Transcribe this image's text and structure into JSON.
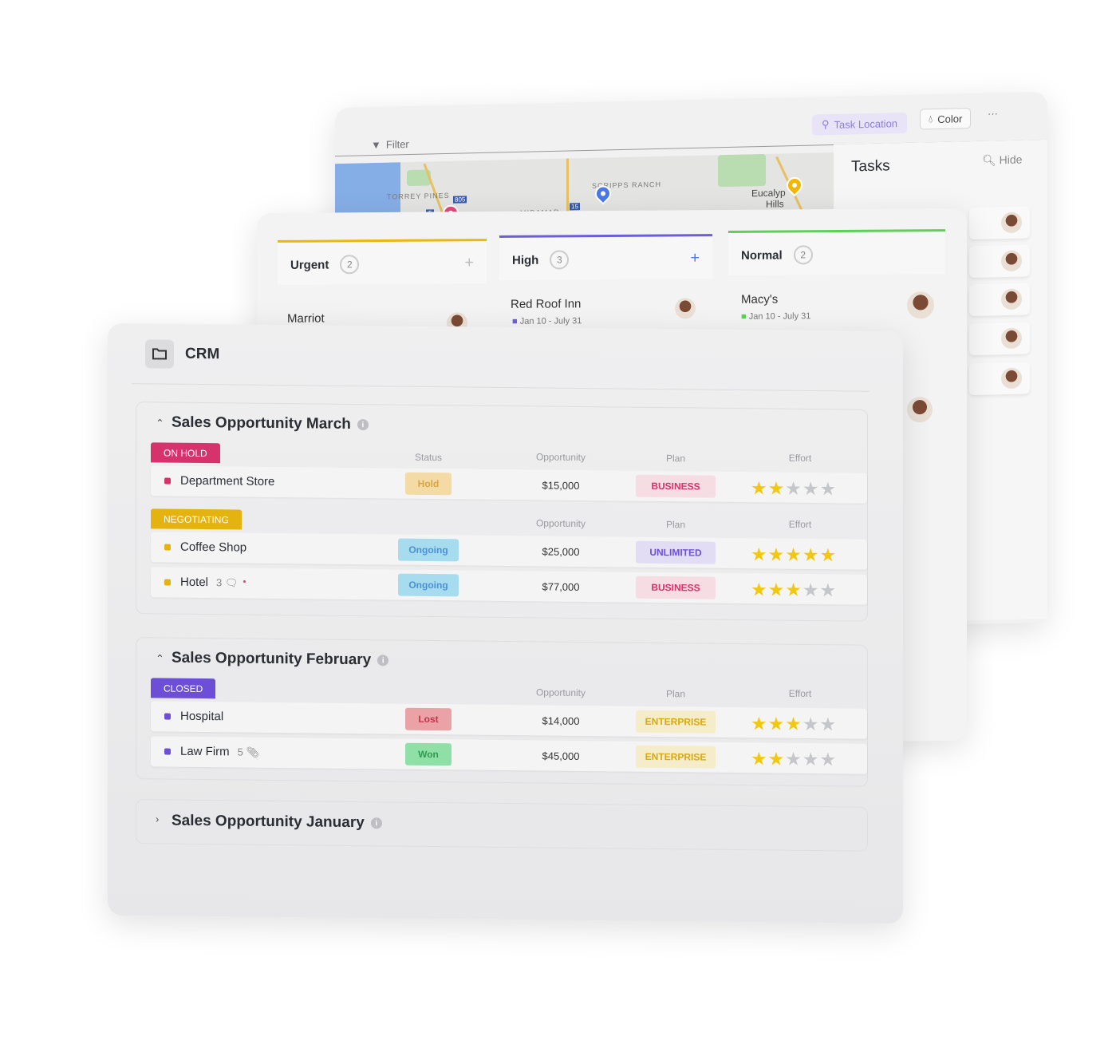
{
  "map_view": {
    "toolbar": {
      "filter_label": "Filter",
      "task_location_label": "Task Location",
      "color_label": "Color",
      "more_label": "···"
    },
    "map_labels": [
      "TORREY PINES",
      "SCRIPPS RANCH",
      "MIRAMAR",
      "Eucalyp",
      "Hills"
    ],
    "highway_shields": [
      "805",
      "5",
      "15"
    ],
    "pin_colors": [
      "#e6487a",
      "#4a78e8",
      "#f2b705"
    ],
    "tasks_panel": {
      "title": "Tasks",
      "hide_label": "Hide"
    }
  },
  "board_view": {
    "columns": [
      {
        "label": "Urgent",
        "count": "2",
        "color": "#e7b812",
        "card": {
          "title": "Marriot"
        }
      },
      {
        "label": "High",
        "count": "3",
        "color": "#6b5fd6",
        "card": {
          "title": "Red Roof Inn",
          "dates": "Jan 10 - July 31"
        }
      },
      {
        "label": "Normal",
        "count": "2",
        "color": "#5fcf5a",
        "card": {
          "title": "Macy's",
          "dates": "Jan 10 - July 31"
        }
      }
    ]
  },
  "crm": {
    "title": "CRM",
    "headers": {
      "status": "Status",
      "opportunity": "Opportunity",
      "plan": "Plan",
      "effort": "Effort"
    },
    "sections": [
      {
        "title": "Sales Opportunity March",
        "expanded": true,
        "groups": [
          {
            "label": "ON HOLD",
            "color": "#d6336c",
            "show_status_header": true,
            "rows": [
              {
                "name": "Department Store",
                "status": "Hold",
                "opportunity": "$15,000",
                "plan": "BUSINESS",
                "effort": 2
              }
            ]
          },
          {
            "label": "NEGOTIATING",
            "color": "#e4b30f",
            "show_status_header": false,
            "rows": [
              {
                "name": "Coffee Shop",
                "status": "Ongoing",
                "opportunity": "$25,000",
                "plan": "UNLIMITED",
                "effort": 5
              },
              {
                "name": "Hotel",
                "extra": "3",
                "extra_icon": "comment-icon",
                "status": "Ongoing",
                "opportunity": "$77,000",
                "plan": "BUSINESS",
                "effort": 3
              }
            ]
          }
        ]
      },
      {
        "title": "Sales Opportunity February",
        "expanded": true,
        "groups": [
          {
            "label": "CLOSED",
            "color": "#6c4fd6",
            "show_status_header": false,
            "rows": [
              {
                "name": "Hospital",
                "status": "Lost",
                "opportunity": "$14,000",
                "plan": "ENTERPRISE",
                "effort": 3
              },
              {
                "name": "Law Firm",
                "extra": "5",
                "extra_icon": "attachment-icon",
                "status": "Won",
                "opportunity": "$45,000",
                "plan": "ENTERPRISE",
                "effort": 2
              }
            ]
          }
        ]
      },
      {
        "title": "Sales Opportunity January",
        "expanded": false,
        "groups": []
      }
    ],
    "status_colors": {
      "Hold": [
        "#f4dba6",
        "#d9a441"
      ],
      "Ongoing": [
        "#a7dcef",
        "#4b90d6"
      ],
      "Lost": [
        "#eba2a6",
        "#c3344a"
      ],
      "Won": [
        "#8fe0a6",
        "#2f9a4f"
      ]
    },
    "plan_colors": {
      "BUSINESS": [
        "#f6dce3",
        "#d6336c"
      ],
      "UNLIMITED": [
        "#e2ddf4",
        "#6c4fd6"
      ],
      "ENTERPRISE": [
        "#f5ecc9",
        "#d9a80f"
      ]
    },
    "star_colors": {
      "filled": "#f2c80f",
      "empty": "#c5c6c9"
    }
  }
}
